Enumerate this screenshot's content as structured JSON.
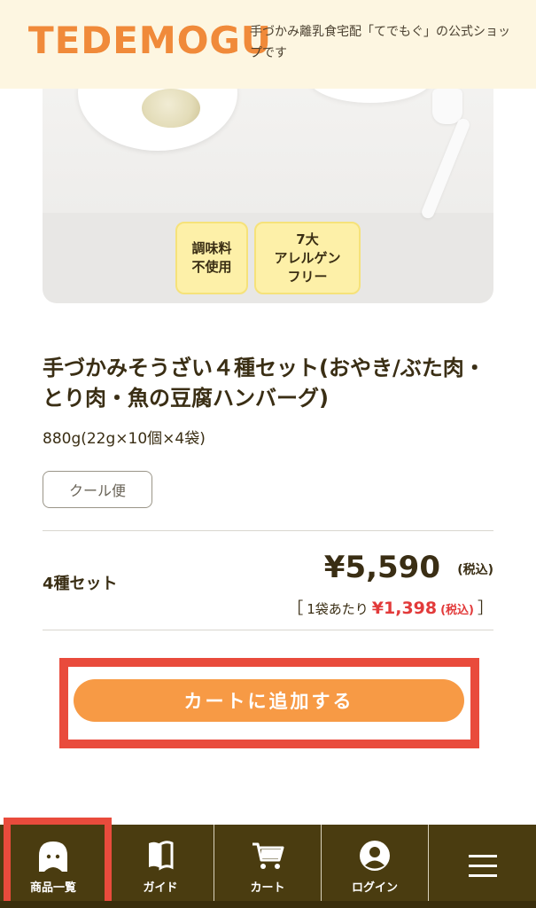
{
  "header": {
    "logo": "TEDEMOGU",
    "tagline": "手づかみ離乳食宅配「てでもぐ」の公式ショップです"
  },
  "badges": {
    "badge1": "調味料\n不使用",
    "badge2": "7大\nアレルゲン\nフリー"
  },
  "product": {
    "title": "手づかみそうざい４種セット(おやき/ぶた肉・とり肉・魚の豆腐ハンバーグ)",
    "weight": "880g(22g×10個×4袋)",
    "shipping_tag": "クール便",
    "variant_name": "4種セット",
    "price": "¥5,590",
    "price_tax": "(税込)",
    "per_bag_label": "1袋あたり",
    "per_bag_price": "¥1,398",
    "per_bag_tax": "(税込)",
    "bracket_open": "［",
    "bracket_close": "］"
  },
  "actions": {
    "add_to_cart": "カートに追加する"
  },
  "bottom_nav": {
    "items": [
      {
        "label": "商品一覧",
        "icon": "ghost-icon"
      },
      {
        "label": "ガイド",
        "icon": "book-icon"
      },
      {
        "label": "カート",
        "icon": "cart-icon"
      },
      {
        "label": "ログイン",
        "icon": "user-icon"
      },
      {
        "label": "",
        "icon": "menu-icon"
      }
    ]
  },
  "colors": {
    "header_bg": "#fdf6e1",
    "logo": "#f08a3a",
    "badge_bg": "#fdf0a8",
    "cart_button": "#f79a45",
    "nav_bg": "#4a3c10",
    "highlight": "#e94b3c",
    "unit_price": "#e23a3a"
  }
}
